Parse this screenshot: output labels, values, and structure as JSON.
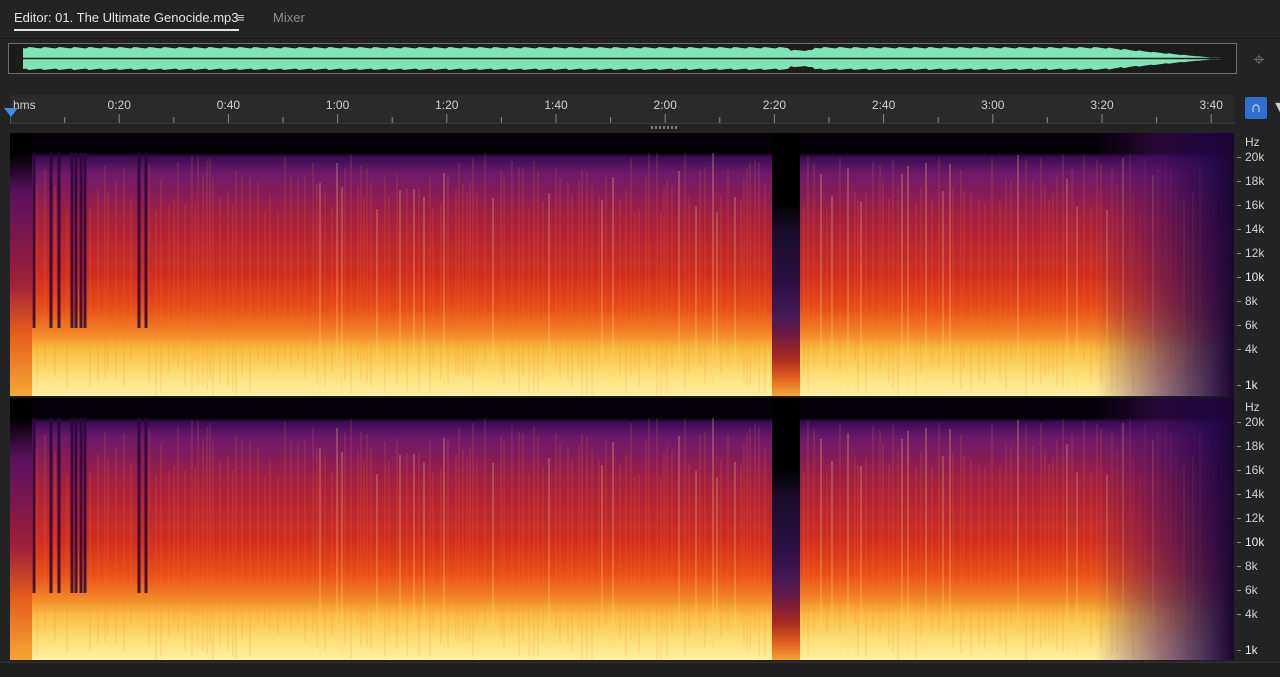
{
  "tabs": {
    "editor_label": "Editor: 01. The Ultimate Genocide.mp3",
    "menu_glyph": "≡",
    "mixer_label": "Mixer"
  },
  "overview": {
    "waveform_color": "#7fe5b6",
    "zoom_icon": "zoom-navigator-icon"
  },
  "ruler": {
    "unit_label": "hms",
    "ticks": [
      "0:20",
      "0:40",
      "1:00",
      "1:20",
      "1:40",
      "2:00",
      "2:20",
      "2:40",
      "3:00",
      "3:20",
      "3:40"
    ],
    "snap_icon": "magnet-icon",
    "filter_icon": "funnel-icon"
  },
  "frequency_scale": {
    "unit": "Hz",
    "labels": [
      "20k",
      "18k",
      "16k",
      "14k",
      "12k",
      "10k",
      "8k",
      "6k",
      "4k",
      "1k"
    ]
  },
  "channels": [
    {
      "name": "channel-left"
    },
    {
      "name": "channel-right"
    }
  ],
  "colors": {
    "accent": "#2e6fd0",
    "spectrum_low": "#fff0a2",
    "spectrum_mid": "#e74d19",
    "spectrum_high": "#3a0c52"
  }
}
